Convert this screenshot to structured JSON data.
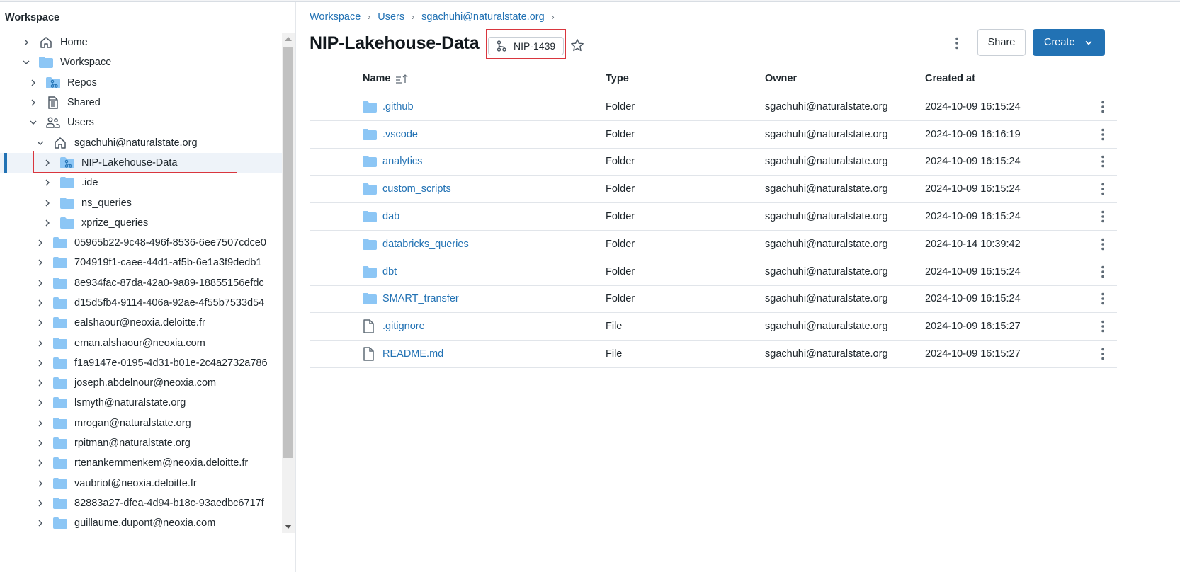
{
  "sidebar": {
    "title": "Workspace",
    "items": [
      {
        "label": "Home",
        "icon": "home-icon",
        "level": 0,
        "expanded": false
      },
      {
        "label": "Workspace",
        "icon": "folder-icon",
        "level": 0,
        "expanded": true
      },
      {
        "label": "Repos",
        "icon": "repo-folder-icon",
        "level": 1,
        "expanded": false
      },
      {
        "label": "Shared",
        "icon": "shared-icon",
        "level": 1,
        "expanded": false
      },
      {
        "label": "Users",
        "icon": "users-icon",
        "level": 1,
        "expanded": true
      },
      {
        "label": "sgachuhi@naturalstate.org",
        "icon": "home-icon",
        "level": 2,
        "expanded": true
      },
      {
        "label": "NIP-Lakehouse-Data",
        "icon": "repo-folder-icon",
        "level": 3,
        "expanded": false,
        "selected": true
      },
      {
        "label": ".ide",
        "icon": "folder-icon",
        "level": 3,
        "expanded": false
      },
      {
        "label": "ns_queries",
        "icon": "folder-icon",
        "level": 3,
        "expanded": false
      },
      {
        "label": "xprize_queries",
        "icon": "folder-icon",
        "level": 3,
        "expanded": false
      },
      {
        "label": "05965b22-9c48-496f-8536-6ee7507cdce0",
        "icon": "folder-icon",
        "level": 2,
        "expanded": false
      },
      {
        "label": "704919f1-caee-44d1-af5b-6e1a3f9dedb1",
        "icon": "folder-icon",
        "level": 2,
        "expanded": false
      },
      {
        "label": "8e934fac-87da-42a0-9a89-18855156efdc",
        "icon": "folder-icon",
        "level": 2,
        "expanded": false
      },
      {
        "label": "d15d5fb4-9114-406a-92ae-4f55b7533d54",
        "icon": "folder-icon",
        "level": 2,
        "expanded": false
      },
      {
        "label": "ealshaour@neoxia.deloitte.fr",
        "icon": "folder-icon",
        "level": 2,
        "expanded": false
      },
      {
        "label": "eman.alshaour@neoxia.com",
        "icon": "folder-icon",
        "level": 2,
        "expanded": false
      },
      {
        "label": "f1a9147e-0195-4d31-b01e-2c4a2732a786",
        "icon": "folder-icon",
        "level": 2,
        "expanded": false
      },
      {
        "label": "joseph.abdelnour@neoxia.com",
        "icon": "folder-icon",
        "level": 2,
        "expanded": false
      },
      {
        "label": "lsmyth@naturalstate.org",
        "icon": "folder-icon",
        "level": 2,
        "expanded": false
      },
      {
        "label": "mrogan@naturalstate.org",
        "icon": "folder-icon",
        "level": 2,
        "expanded": false
      },
      {
        "label": "rpitman@naturalstate.org",
        "icon": "folder-icon",
        "level": 2,
        "expanded": false
      },
      {
        "label": "rtenankemmenkem@neoxia.deloitte.fr",
        "icon": "folder-icon",
        "level": 2,
        "expanded": false
      },
      {
        "label": "vaubriot@neoxia.deloitte.fr",
        "icon": "folder-icon",
        "level": 2,
        "expanded": false
      },
      {
        "label": "82883a27-dfea-4d94-b18c-93aedbc6717f",
        "icon": "folder-icon",
        "level": 2,
        "expanded": false
      },
      {
        "label": "guillaume.dupont@neoxia.com",
        "icon": "folder-icon",
        "level": 2,
        "expanded": false
      }
    ]
  },
  "breadcrumb": [
    "Workspace",
    "Users",
    "sgachuhi@naturalstate.org"
  ],
  "header": {
    "title": "NIP-Lakehouse-Data",
    "branch": "NIP-1439",
    "share_label": "Share",
    "create_label": "Create"
  },
  "table": {
    "columns": [
      "Name",
      "Type",
      "Owner",
      "Created at"
    ],
    "rows": [
      {
        "name": ".github",
        "type": "Folder",
        "owner": "sgachuhi@naturalstate.org",
        "created": "2024-10-09 16:15:24",
        "icon": "folder-icon"
      },
      {
        "name": ".vscode",
        "type": "Folder",
        "owner": "sgachuhi@naturalstate.org",
        "created": "2024-10-09 16:16:19",
        "icon": "folder-icon"
      },
      {
        "name": "analytics",
        "type": "Folder",
        "owner": "sgachuhi@naturalstate.org",
        "created": "2024-10-09 16:15:24",
        "icon": "folder-icon"
      },
      {
        "name": "custom_scripts",
        "type": "Folder",
        "owner": "sgachuhi@naturalstate.org",
        "created": "2024-10-09 16:15:24",
        "icon": "folder-icon"
      },
      {
        "name": "dab",
        "type": "Folder",
        "owner": "sgachuhi@naturalstate.org",
        "created": "2024-10-09 16:15:24",
        "icon": "folder-icon"
      },
      {
        "name": "databricks_queries",
        "type": "Folder",
        "owner": "sgachuhi@naturalstate.org",
        "created": "2024-10-14 10:39:42",
        "icon": "folder-icon"
      },
      {
        "name": "dbt",
        "type": "Folder",
        "owner": "sgachuhi@naturalstate.org",
        "created": "2024-10-09 16:15:24",
        "icon": "folder-icon"
      },
      {
        "name": "SMART_transfer",
        "type": "Folder",
        "owner": "sgachuhi@naturalstate.org",
        "created": "2024-10-09 16:15:24",
        "icon": "folder-icon"
      },
      {
        "name": ".gitignore",
        "type": "File",
        "owner": "sgachuhi@naturalstate.org",
        "created": "2024-10-09 16:15:27",
        "icon": "file-icon"
      },
      {
        "name": "README.md",
        "type": "File",
        "owner": "sgachuhi@naturalstate.org",
        "created": "2024-10-09 16:15:27",
        "icon": "file-icon"
      }
    ]
  },
  "colors": {
    "accent": "#2272b4",
    "folder": "#8cc6f5",
    "highlight_box": "#d9363e",
    "selected_row_bg": "#eef3f9"
  }
}
